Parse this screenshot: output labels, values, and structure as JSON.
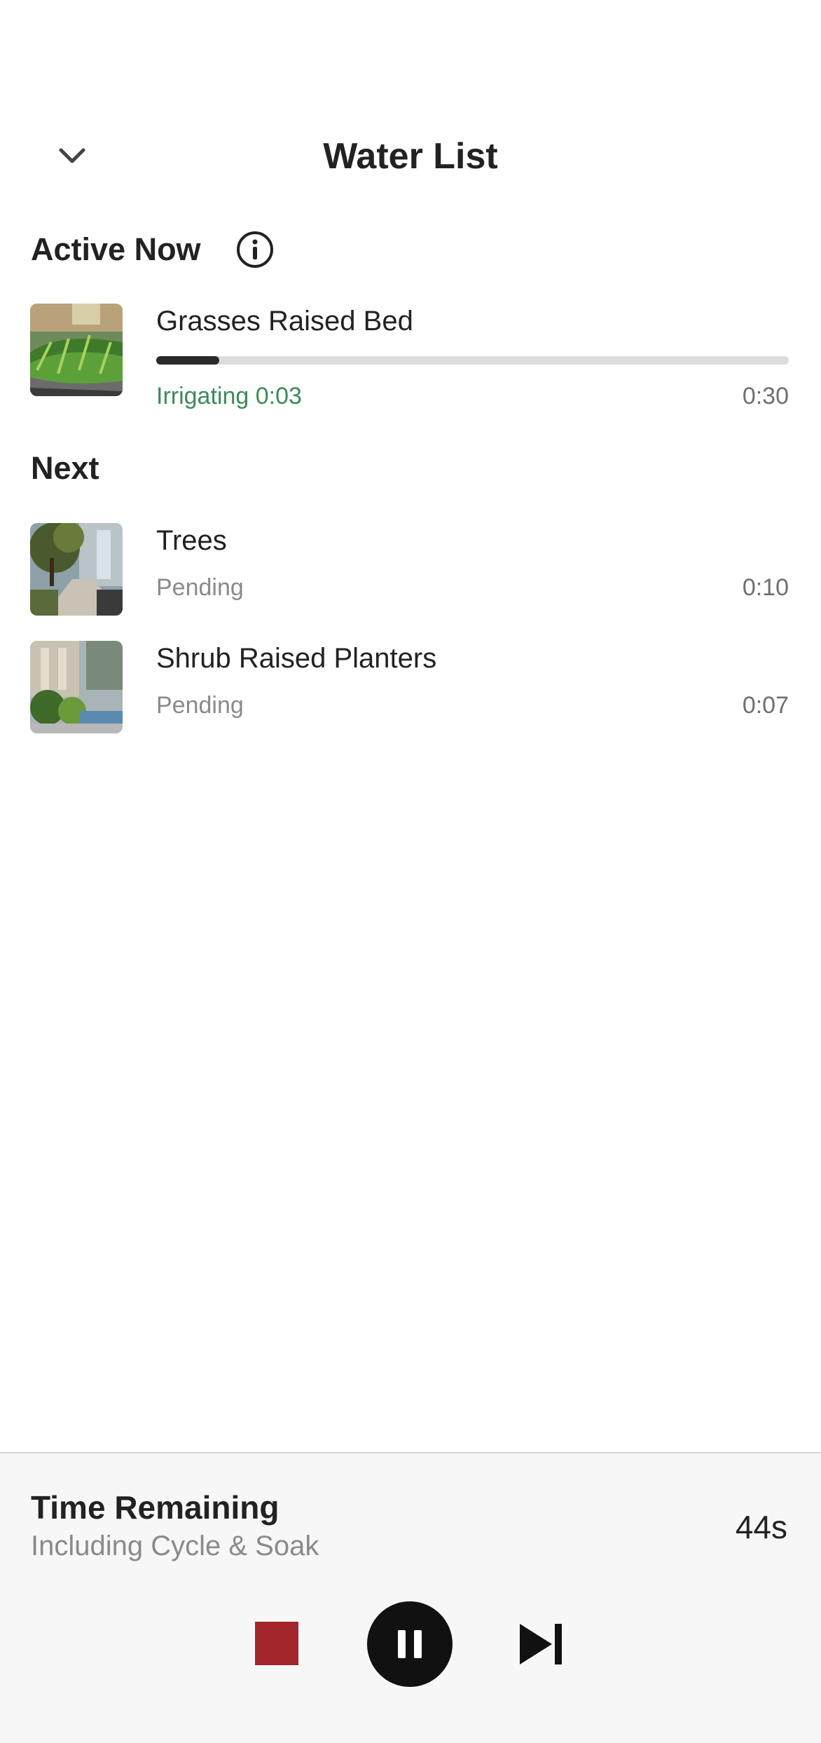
{
  "header": {
    "title": "Water List",
    "collapse_icon": "chevron-down-icon"
  },
  "active_section": {
    "title": "Active Now",
    "info_icon": "info-icon",
    "zone": {
      "name": "Grasses Raised Bed",
      "status": "Irrigating 0:03",
      "duration": "0:30",
      "progress": 0.1,
      "status_color": "#3d8a5a"
    }
  },
  "next_section": {
    "title": "Next",
    "zones": [
      {
        "name": "Trees",
        "status": "Pending",
        "duration": "0:10"
      },
      {
        "name": "Shrub Raised Planters",
        "status": "Pending",
        "duration": "0:07"
      }
    ]
  },
  "footer": {
    "title": "Time Remaining",
    "subtitle": "Including Cycle & Soak",
    "time": "44s",
    "controls": {
      "stop_icon": "stop-icon",
      "pause_icon": "pause-icon",
      "skip_icon": "skip-next-icon",
      "stop_color": "#a3262c"
    }
  }
}
